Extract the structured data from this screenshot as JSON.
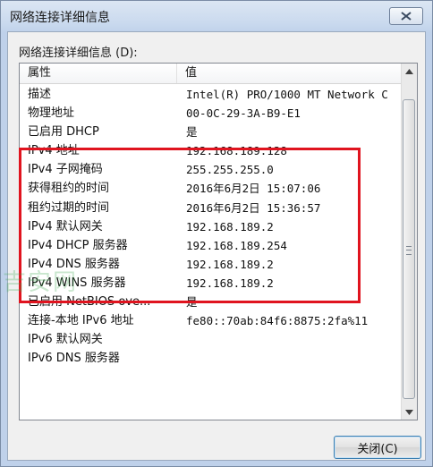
{
  "window": {
    "title": "网络连接详细信息"
  },
  "group_label": "网络连接详细信息 (D):",
  "list": {
    "columns": [
      "属性",
      "值"
    ],
    "rows": [
      {
        "property": "描述",
        "value": "Intel(R) PRO/1000 MT Network C"
      },
      {
        "property": "物理地址",
        "value": "00-0C-29-3A-B9-E1"
      },
      {
        "property": "已启用 DHCP",
        "value": "是"
      },
      {
        "property": "IPv4 地址",
        "value": "192.168.189.128"
      },
      {
        "property": "IPv4 子网掩码",
        "value": "255.255.255.0"
      },
      {
        "property": "获得租约的时间",
        "value": "2016年6月2日 15:07:06"
      },
      {
        "property": "租约过期的时间",
        "value": "2016年6月2日 15:36:57"
      },
      {
        "property": "IPv4 默认网关",
        "value": "192.168.189.2"
      },
      {
        "property": "IPv4 DHCP 服务器",
        "value": "192.168.189.254"
      },
      {
        "property": "IPv4 DNS 服务器",
        "value": "192.168.189.2"
      },
      {
        "property": "IPv4 WINS 服务器",
        "value": "192.168.189.2"
      },
      {
        "property": "已启用 NetBIOS ove...",
        "value": "是"
      },
      {
        "property": "连接-本地 IPv6 地址",
        "value": "fe80::70ab:84f6:8875:2fa%11"
      },
      {
        "property": "IPv6 默认网关",
        "value": ""
      },
      {
        "property": "IPv6 DNS 服务器",
        "value": ""
      }
    ]
  },
  "watermark": "吉安网",
  "buttons": {
    "close_label": "关闭(C)"
  },
  "colors": {
    "highlight": "#e0141f",
    "accent_border": "#3c7fb1"
  }
}
